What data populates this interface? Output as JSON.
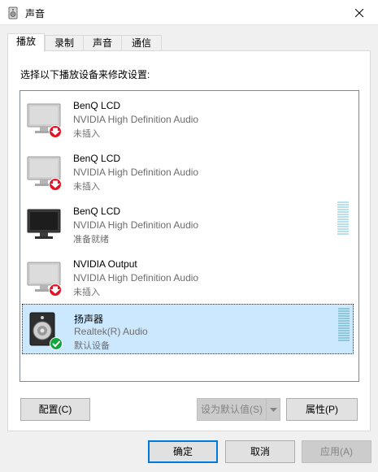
{
  "window": {
    "title": "声音",
    "icon": "speaker-icon",
    "close": "close-icon"
  },
  "tabs": [
    {
      "label": "播放",
      "active": true
    },
    {
      "label": "录制",
      "active": false
    },
    {
      "label": "声音",
      "active": false
    },
    {
      "label": "通信",
      "active": false
    }
  ],
  "instruction": "选择以下播放设备来修改设置:",
  "devices": [
    {
      "name": "BenQ LCD",
      "driver": "NVIDIA High Definition Audio",
      "status": "未插入",
      "icon": "monitor-disconnected-icon"
    },
    {
      "name": "BenQ LCD",
      "driver": "NVIDIA High Definition Audio",
      "status": "未插入",
      "icon": "monitor-disconnected-icon"
    },
    {
      "name": "BenQ LCD",
      "driver": "NVIDIA High Definition Audio",
      "status": "准备就绪",
      "icon": "monitor-ready-icon"
    },
    {
      "name": "NVIDIA Output",
      "driver": "NVIDIA High Definition Audio",
      "status": "未插入",
      "icon": "monitor-disconnected-icon"
    },
    {
      "name": "扬声器",
      "driver": "Realtek(R) Audio",
      "status": "默认设备",
      "icon": "speaker-default-icon",
      "selected": true
    }
  ],
  "buttons": {
    "configure": "配置(C)",
    "set_default": "设为默认值(S)",
    "properties": "属性(P)",
    "ok": "确定",
    "cancel": "取消",
    "apply": "应用(A)"
  },
  "colors": {
    "selection": "#cce8ff",
    "accent": "#0078d7",
    "disconnected": "#e81123",
    "default_check": "#12a53d"
  }
}
